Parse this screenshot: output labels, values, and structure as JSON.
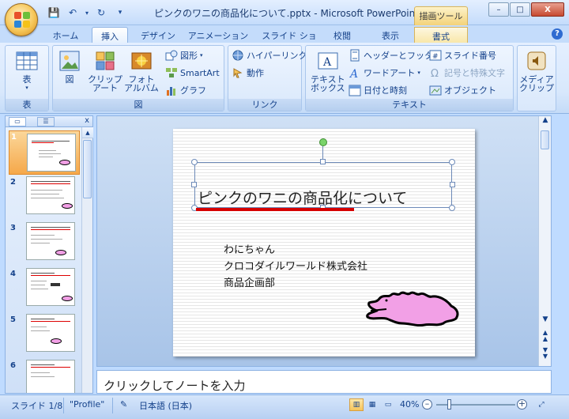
{
  "window": {
    "title": "ピンクのワニの商品化について.pptx - Microsoft PowerPoint",
    "context_header": "描画ツール",
    "minimize": "–",
    "maximize": "□",
    "close": "X"
  },
  "qat": {
    "save": "💾",
    "undo": "↶",
    "redo": "↻",
    "more": "▾"
  },
  "tabs": [
    {
      "label": "ホーム"
    },
    {
      "label": "挿入"
    },
    {
      "label": "デザイン"
    },
    {
      "label": "アニメーション"
    },
    {
      "label": "スライド ショー"
    },
    {
      "label": "校閲"
    },
    {
      "label": "表示"
    },
    {
      "label": "書式"
    }
  ],
  "ribbon": {
    "table_group": {
      "label": "表",
      "button": "表"
    },
    "image_group": {
      "label": "図",
      "picture": "図",
      "clipart": [
        "クリップ",
        "アート"
      ],
      "photo_album": [
        "フォト",
        "アルバム"
      ],
      "shapes": "図形",
      "smartart": "SmartArt",
      "chart": "グラフ"
    },
    "link_group": {
      "label": "リンク",
      "hyperlink": "ハイパーリンク",
      "action": "動作"
    },
    "text_group": {
      "label": "テキスト",
      "textbox": [
        "テキスト",
        "ボックス"
      ],
      "header_footer": "ヘッダーとフッター",
      "wordart": "ワードアート",
      "datetime": "日付と時刻",
      "slide_number": "スライド番号",
      "symbol": "記号と特殊文字",
      "object": "オブジェクト"
    },
    "media_group": {
      "button": [
        "メディア",
        "クリップ"
      ]
    }
  },
  "slides_pane": {
    "numbers": [
      "1",
      "2",
      "3",
      "4",
      "5",
      "6"
    ]
  },
  "slide": {
    "title": "ピンクのワニの商品化について",
    "lines": [
      "わにちゃん",
      "クロコダイルワールド株式会社",
      "商品企画部"
    ]
  },
  "notes": {
    "placeholder": "クリックしてノートを入力"
  },
  "status": {
    "slide_counter": "スライド 1/8",
    "theme": "\"Profile\"",
    "language": "日本語 (日本)",
    "zoom": "40%"
  },
  "colors": {
    "title_underline": "#d60000",
    "crocodile_fill": "#f2a0e6",
    "ribbon_text": "#15428b"
  }
}
